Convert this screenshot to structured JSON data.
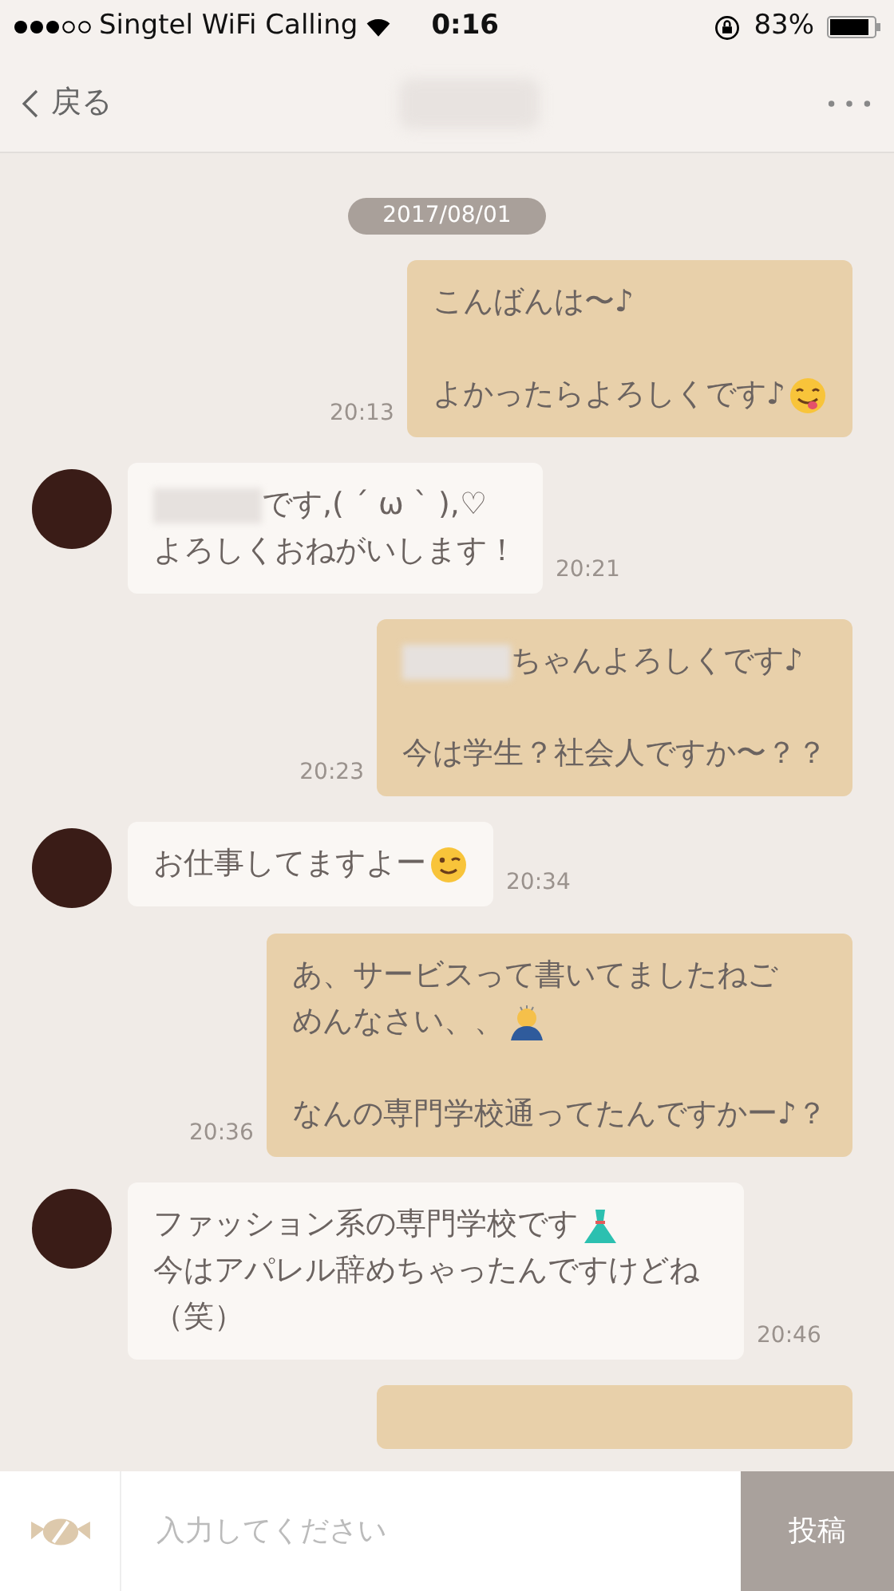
{
  "status_bar": {
    "carrier": "Singtel WiFi Calling",
    "time": "0:16",
    "battery": "83%"
  },
  "nav": {
    "back": "戻る"
  },
  "date_chip": "2017/08/01",
  "messages": [
    {
      "kind": "outgoing",
      "time": "20:13",
      "paragraphs": [
        [
          [
            {
              "kind": "text",
              "text": "こんばんは〜♪"
            }
          ]
        ],
        [
          [
            {
              "kind": "text",
              "text": "よかったらよろしくです♪"
            },
            {
              "kind": "icon"
            }
          ]
        ]
      ]
    },
    {
      "kind": "incoming",
      "time": "20:21",
      "paragraphs": [
        [
          [
            {
              "kind": "redacted"
            },
            {
              "kind": "text",
              "text": "です,( ´ ω ` ),♡"
            }
          ],
          [
            {
              "kind": "text",
              "text": "よろしくおねがいします！"
            }
          ]
        ]
      ]
    },
    {
      "kind": "outgoing",
      "time": "20:23",
      "paragraphs": [
        [
          [
            {
              "kind": "redacted"
            },
            {
              "kind": "text",
              "text": "ちゃんよろしくです♪"
            }
          ]
        ],
        [
          [
            {
              "kind": "text",
              "text": "今は学生？社会人ですか〜？？"
            }
          ]
        ]
      ]
    },
    {
      "kind": "incoming",
      "time": "20:34",
      "paragraphs": [
        [
          [
            {
              "kind": "text",
              "text": "お仕事してますよー"
            },
            {
              "kind": "icon"
            }
          ]
        ]
      ]
    },
    {
      "kind": "outgoing",
      "time": "20:36",
      "paragraphs": [
        [
          [
            {
              "kind": "text",
              "text": "あ、サービスって書いてましたねご"
            }
          ],
          [
            {
              "kind": "text",
              "text": "めんなさい、、"
            },
            {
              "kind": "icon"
            }
          ]
        ],
        [
          [
            {
              "kind": "text",
              "text": "なんの専門学校通ってたんですかー♪？"
            }
          ]
        ]
      ]
    },
    {
      "kind": "incoming",
      "time": "20:46",
      "paragraphs": [
        [
          [
            {
              "kind": "text",
              "text": "ファッション系の専門学校です"
            },
            {
              "kind": "icon"
            }
          ],
          [
            {
              "kind": "text",
              "text": "今はアパレル辞めちゃったんですけどね（笑）"
            }
          ]
        ]
      ]
    },
    {
      "kind": "outgoing"
    }
  ],
  "composer": {
    "placeholder": "入力してください",
    "send": "投稿"
  }
}
